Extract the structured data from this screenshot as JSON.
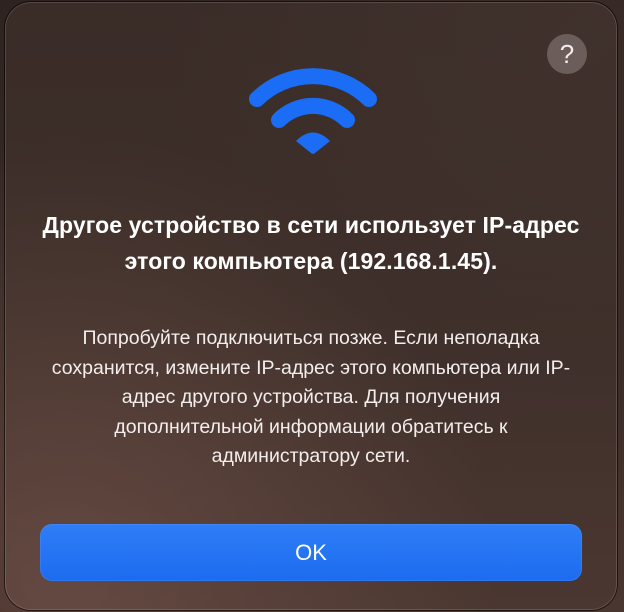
{
  "dialog": {
    "help_label": "?",
    "icon": "wifi-icon",
    "title": "Другое устройство в сети использует IP-адрес этого компьютера (192.168.1.45).",
    "message": "Попробуйте подключиться позже. Если неполадка сохранится, измените IP-адрес этого компьютера или IP-адрес другого устройства. Для получения дополнительной информации обратитесь к администратору сети.",
    "ok_label": "OK"
  },
  "colors": {
    "accent": "#1f6ff2",
    "icon": "#1a6df4"
  }
}
